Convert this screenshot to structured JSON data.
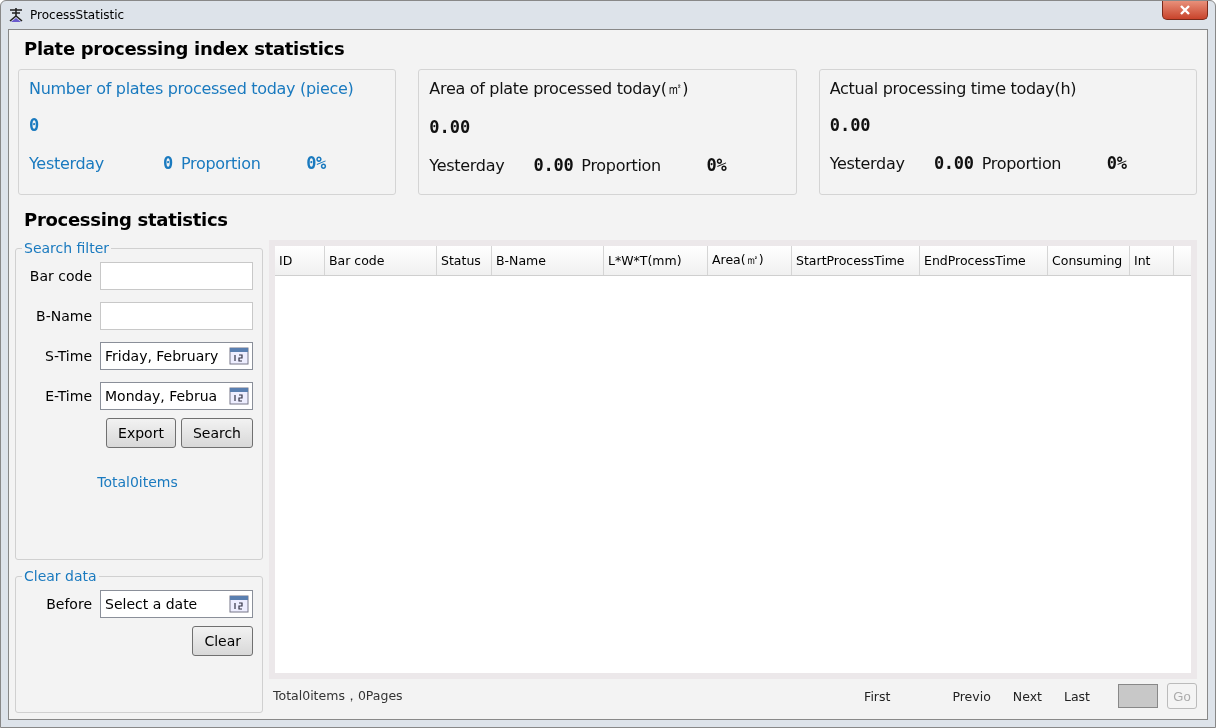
{
  "window": {
    "title": "ProcessStatistic"
  },
  "heading": "Plate processing index statistics",
  "cards": [
    {
      "title": "Number of plates processed today (piece)",
      "value": "0",
      "yesterday_label": "Yesterday",
      "yesterday_value": "0",
      "proportion_label": "Proportion",
      "proportion_value": "0%",
      "selected": true
    },
    {
      "title": "Area of plate processed today(㎡)",
      "value": "0.00",
      "yesterday_label": "Yesterday",
      "yesterday_value": "0.00",
      "proportion_label": "Proportion",
      "proportion_value": "0%",
      "selected": false
    },
    {
      "title": "Actual processing time today(h)",
      "value": "0.00",
      "yesterday_label": "Yesterday",
      "yesterday_value": "0.00",
      "proportion_label": "Proportion",
      "proportion_value": "0%",
      "selected": false
    }
  ],
  "section_heading": "Processing statistics",
  "search_filter": {
    "legend": "Search filter",
    "fields": [
      {
        "kind": "text",
        "label": "Bar code"
      },
      {
        "kind": "text",
        "label": "B-Name"
      },
      {
        "kind": "date",
        "label": "S-Time",
        "value": "Friday, February"
      },
      {
        "kind": "date",
        "label": "E-Time",
        "value": "Monday, Februa"
      }
    ],
    "buttons": [
      "Export",
      "Search"
    ],
    "total": "Total0items"
  },
  "clear_data": {
    "legend": "Clear data",
    "label": "Before",
    "placeholder": "Select a date",
    "button": "Clear"
  },
  "table": {
    "columns": [
      "ID",
      "Bar code",
      "Status",
      "B-Name",
      "L*W*T(mm)",
      "Area(㎡)",
      "StartProcessTime",
      "EndProcessTime",
      "Consuming",
      "Int"
    ]
  },
  "footer": {
    "summary": "Total0items，0Pages",
    "pager": [
      "First",
      "Previo",
      "Next",
      "Last"
    ],
    "go": {
      "label": "Go",
      "disabled": true
    }
  }
}
